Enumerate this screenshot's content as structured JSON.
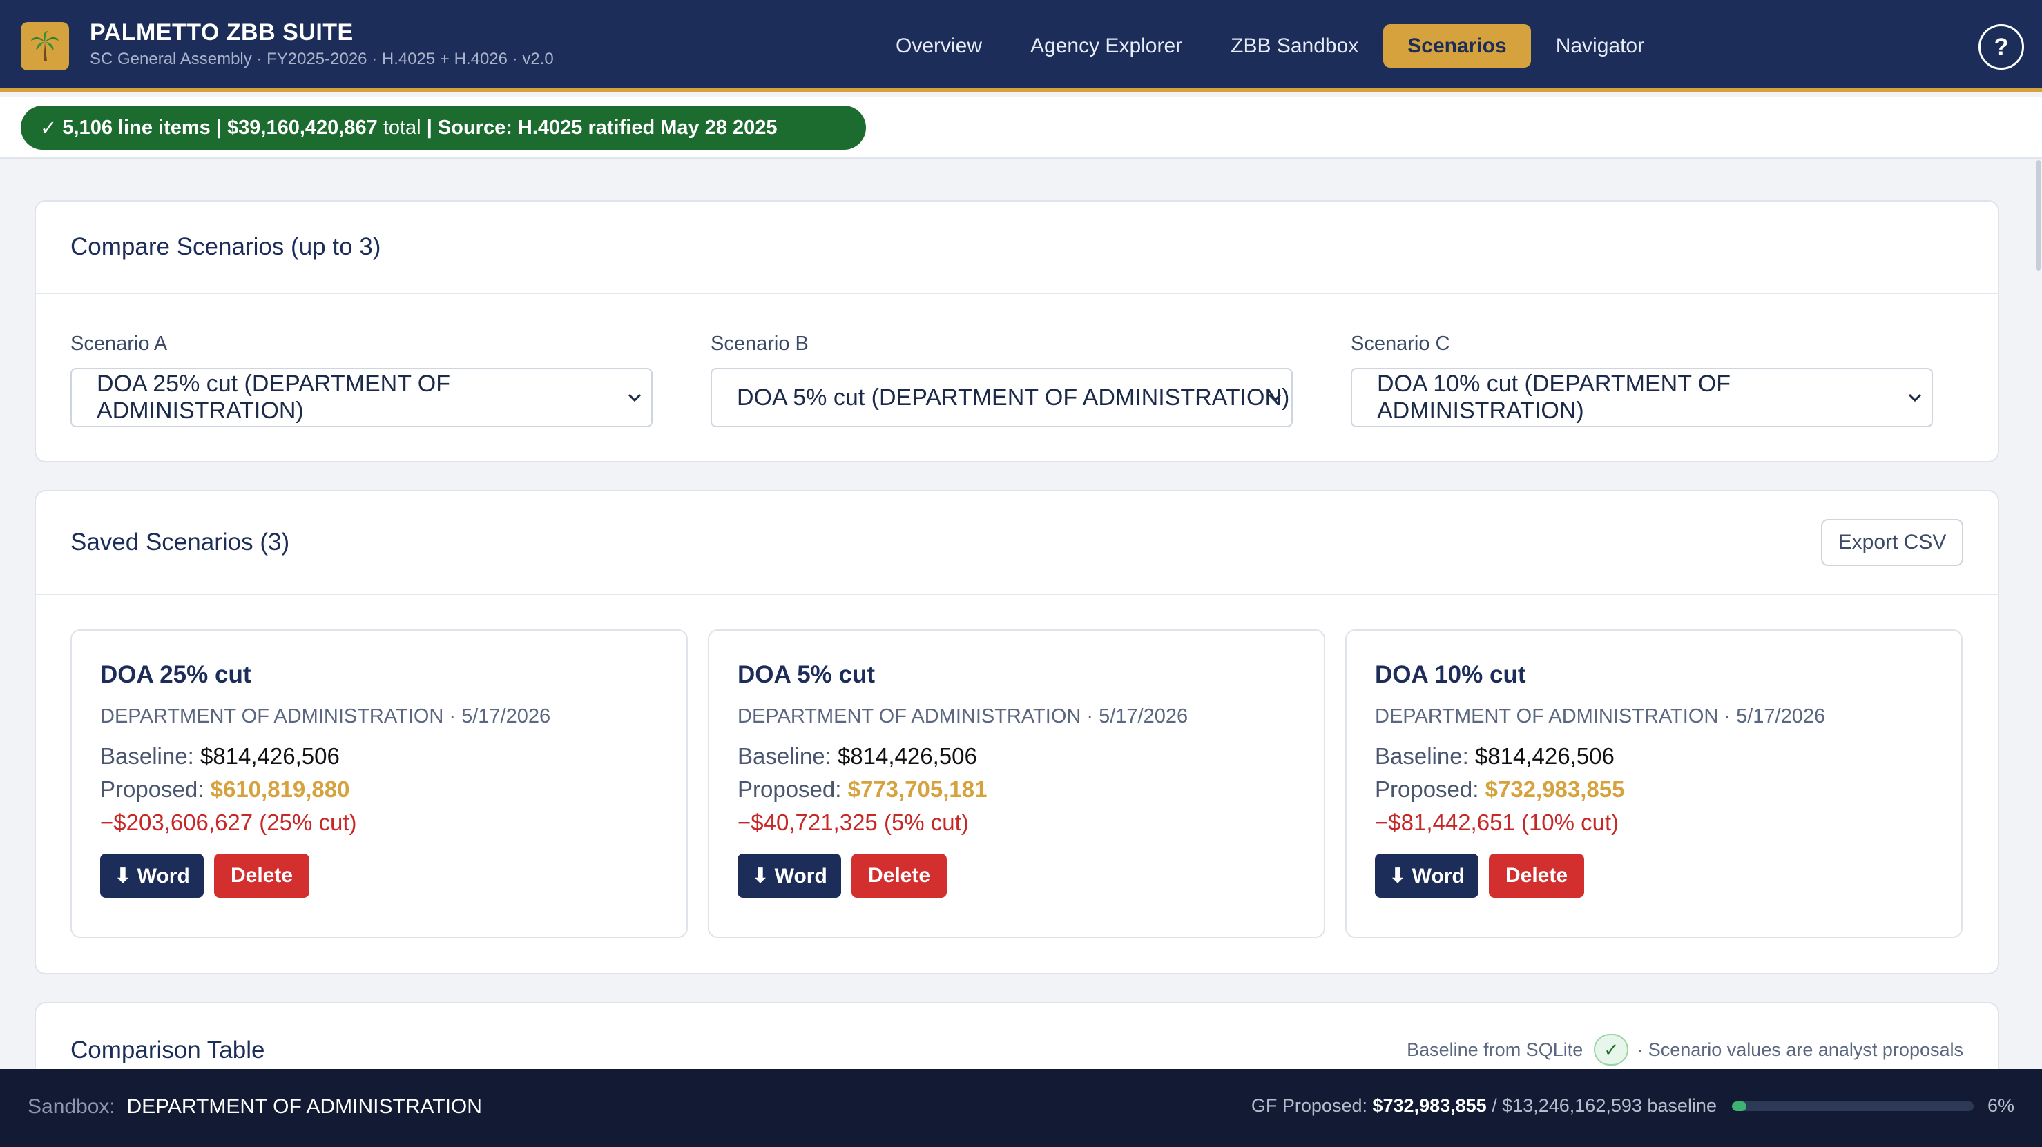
{
  "header": {
    "title": "PALMETTO ZBB SUITE",
    "subtitle": "SC General Assembly · FY2025-2026 · H.4025 + H.4026 · v2.0",
    "logo_icon": "palm-tree-icon",
    "tabs": [
      "Overview",
      "Agency Explorer",
      "ZBB Sandbox",
      "Scenarios",
      "Navigator"
    ],
    "active_tab": "Scenarios",
    "help_label": "?"
  },
  "status": {
    "check": "✓",
    "line_items": "5,106 line items",
    "sep1": "|",
    "total_amount": "$39,160,420,867",
    "total_label": "total",
    "sep2": "|",
    "source": "Source: H.4025 ratified May 28 2025"
  },
  "compare": {
    "title": "Compare Scenarios (up to 3)",
    "selects": [
      {
        "label": "Scenario A",
        "value": "DOA 25% cut (DEPARTMENT OF ADMINISTRATION)"
      },
      {
        "label": "Scenario B",
        "value": "DOA 5% cut (DEPARTMENT OF ADMINISTRATION)"
      },
      {
        "label": "Scenario C",
        "value": "DOA 10% cut (DEPARTMENT OF ADMINISTRATION)"
      }
    ]
  },
  "saved": {
    "title": "Saved Scenarios (3)",
    "export_label": "Export CSV",
    "baseline_label": "Baseline:",
    "proposed_label": "Proposed:",
    "word_label": "⬇ Word",
    "delete_label": "Delete",
    "scenarios": [
      {
        "name": "DOA 25% cut",
        "meta": "DEPARTMENT OF ADMINISTRATION · 5/17/2026",
        "baseline": "$814,426,506",
        "proposed": "$610,819,880",
        "diff": "−$203,606,627 (25% cut)"
      },
      {
        "name": "DOA 5% cut",
        "meta": "DEPARTMENT OF ADMINISTRATION · 5/17/2026",
        "baseline": "$814,426,506",
        "proposed": "$773,705,181",
        "diff": "−$40,721,325 (5% cut)"
      },
      {
        "name": "DOA 10% cut",
        "meta": "DEPARTMENT OF ADMINISTRATION · 5/17/2026",
        "baseline": "$814,426,506",
        "proposed": "$732,983,855",
        "diff": "−$81,442,651 (10% cut)"
      }
    ]
  },
  "comparison": {
    "title": "Comparison Table",
    "note_left": "Baseline from SQLite",
    "note_check": "✓",
    "note_right": "· Scenario values are analyst proposals"
  },
  "footer": {
    "sandbox_label": "Sandbox:",
    "sandbox_value": "DEPARTMENT OF ADMINISTRATION",
    "gf_label": "GF Proposed:",
    "gf_value": "$732,983,855",
    "gf_baseline": "/ $13,246,162,593 baseline",
    "progress_percent": 6,
    "progress_label": "6%"
  },
  "colors": {
    "navy": "#1c2d59",
    "gold": "#d6a23e",
    "green": "#1c6b2f",
    "red": "#d32f2f"
  }
}
